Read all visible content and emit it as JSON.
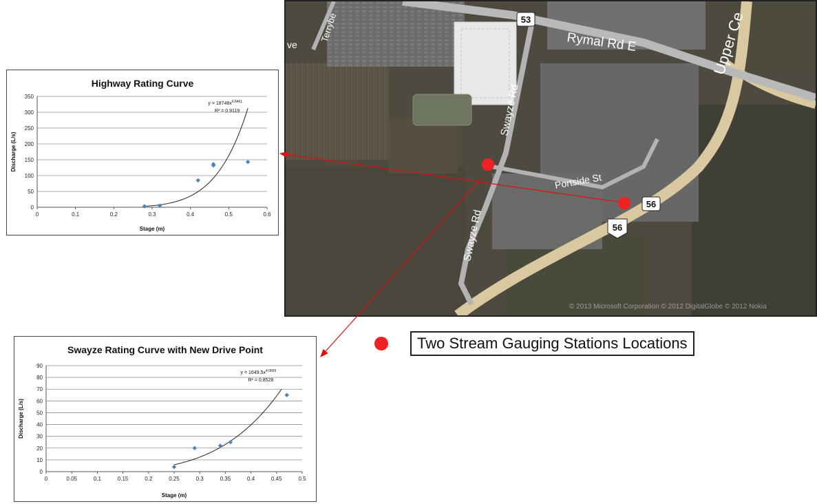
{
  "chart_data": [
    {
      "type": "scatter",
      "title": "Highway Rating Curve",
      "xlabel": "Stage (m)",
      "ylabel": "Discharge (L/s)",
      "xlim": [
        0,
        0.6
      ],
      "ylim": [
        0,
        350
      ],
      "xticks": [
        0,
        0.1,
        0.2,
        0.3,
        0.4,
        0.5,
        0.6
      ],
      "xtick_labels": [
        "0",
        "0.1",
        "0.2",
        "0.3",
        "0.4",
        "0.5",
        "0.6"
      ],
      "yticks": [
        0,
        50,
        100,
        150,
        200,
        250,
        300,
        350
      ],
      "ytick_labels": [
        "0",
        "50",
        "100",
        "150",
        "200",
        "250",
        "300",
        "350"
      ],
      "grid": true,
      "x": [
        0.28,
        0.32,
        0.42,
        0.46,
        0.46,
        0.55
      ],
      "y": [
        3,
        5,
        85,
        132,
        136,
        143
      ],
      "trendline": {
        "equation_base": "y = 18748x",
        "equation_exp": "6.8461",
        "r2_label": "R² = 0.9119",
        "a": 18748,
        "b": 6.8461,
        "x_range": [
          0.28,
          0.55
        ]
      },
      "marker_color": "#4f81bd"
    },
    {
      "type": "scatter",
      "title": "Swayze Rating Curve with New Drive Point",
      "xlabel": "Stage (m)",
      "ylabel": "Discharge (L/s)",
      "xlim": [
        0,
        0.5
      ],
      "ylim": [
        0,
        90
      ],
      "xticks": [
        0,
        0.05,
        0.1,
        0.15,
        0.2,
        0.25,
        0.3,
        0.35,
        0.4,
        0.45,
        0.5
      ],
      "xtick_labels": [
        "0",
        "0.05",
        "0.1",
        "0.15",
        "0.2",
        "0.25",
        "0.3",
        "0.35",
        "0.4",
        "0.45",
        "0.5"
      ],
      "yticks": [
        0,
        10,
        20,
        30,
        40,
        50,
        60,
        70,
        80,
        90
      ],
      "ytick_labels": [
        "0",
        "10",
        "20",
        "30",
        "40",
        "50",
        "60",
        "70",
        "80",
        "90"
      ],
      "grid": true,
      "x": [
        0.25,
        0.29,
        0.34,
        0.36,
        0.47
      ],
      "y": [
        4,
        20,
        22,
        25,
        65
      ],
      "trendline": {
        "equation_base": "y = 1649.5x",
        "equation_exp": "4.0665",
        "r2_label": "R² = 0.8528",
        "a": 1649.5,
        "b": 4.0665,
        "x_range": [
          0.25,
          0.46
        ]
      },
      "marker_color": "#4f81bd"
    }
  ],
  "map": {
    "labels": {
      "rymal": "Rymal Rd E",
      "upper": "Upper Ce",
      "terry": "Terrybe",
      "swayze_north": "Swayze Rd",
      "swayze_south": "Swayze Rd",
      "portside": "Portside St",
      "ve": "ve",
      "route53": "53",
      "route56a": "56",
      "route56b": "56",
      "copyright": "© 2013 Microsoft Corporation   © 2012 DigitalGlobe   © 2012 Nokia"
    },
    "station_color": "#ee2222"
  },
  "legend": {
    "label": "Two Stream Gauging Stations Locations",
    "dot_color": "#ee2222"
  }
}
